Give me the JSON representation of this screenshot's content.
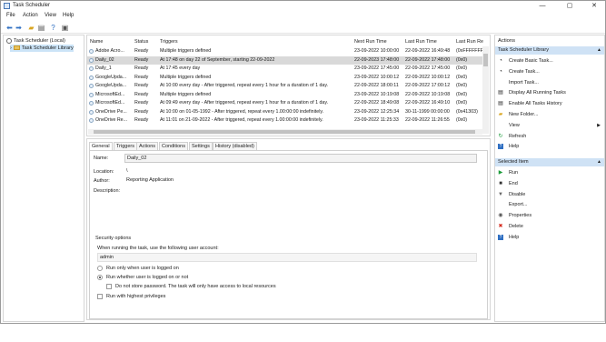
{
  "window": {
    "title": "Task Scheduler",
    "controls": {
      "minimize": "—",
      "maximize": "▢",
      "close": "✕"
    }
  },
  "menu": [
    "File",
    "Action",
    "View",
    "Help"
  ],
  "toolbar": {
    "icons": [
      "back-arrow-icon",
      "forward-arrow-icon",
      "folder-icon",
      "properties-icon",
      "help-icon",
      "panel-icon"
    ]
  },
  "tree": {
    "root": "Task Scheduler (Local)",
    "child": "Task Scheduler Library"
  },
  "tasklist": {
    "columns": [
      "Name",
      "Status",
      "Triggers",
      "Next Run Time",
      "Last Run Time",
      "Last Run Re"
    ],
    "rows": [
      {
        "name": "Adobe Acro...",
        "status": "Ready",
        "triggers": "Multiple triggers defined",
        "next": "23-09-2022 10:00:00",
        "last": "22-09-2022 16:49:48",
        "result": "(0xFFFFFFFF"
      },
      {
        "name": "Daily_02",
        "status": "Ready",
        "triggers": "At 17:48  on day 22 of September, starting 22-09-2022",
        "next": "22-09-2023 17:48:00",
        "last": "22-09-2022 17:48:00",
        "result": "(0x0)"
      },
      {
        "name": "Daily_1",
        "status": "Ready",
        "triggers": "At 17:45 every day",
        "next": "23-09-2022 17:45:00",
        "last": "22-09-2022 17:45:00",
        "result": "(0x0)"
      },
      {
        "name": "GoogleUpda...",
        "status": "Ready",
        "triggers": "Multiple triggers defined",
        "next": "23-09-2022 10:00:12",
        "last": "22-09-2022 10:00:12",
        "result": "(0x0)"
      },
      {
        "name": "GoogleUpda...",
        "status": "Ready",
        "triggers": "At 10:00 every day - After triggered, repeat every 1 hour for a duration of 1 day.",
        "next": "22-09-2022 18:00:11",
        "last": "22-09-2022 17:00:12",
        "result": "(0x0)"
      },
      {
        "name": "MicrosoftEd...",
        "status": "Ready",
        "triggers": "Multiple triggers defined",
        "next": "23-09-2022 10:19:08",
        "last": "22-09-2022 10:19:08",
        "result": "(0x0)"
      },
      {
        "name": "MicrosoftEd...",
        "status": "Ready",
        "triggers": "At 09:49 every day - After triggered, repeat every 1 hour for a duration of 1 day.",
        "next": "22-09-2022 18:49:08",
        "last": "22-09-2022 16:49:10",
        "result": "(0x0)"
      },
      {
        "name": "OneDrive Pe...",
        "status": "Ready",
        "triggers": "At 10:00 on 01-05-1992 - After triggered, repeat every 1.00:00:00 indefinitely.",
        "next": "23-09-2022 12:25:34",
        "last": "30-11-1999 00:00:00",
        "result": "(0x41303)"
      },
      {
        "name": "OneDrive Re...",
        "status": "Ready",
        "triggers": "At 11:01 on 21-09-2022 - After triggered, repeat every 1.00:00:00 indefinitely.",
        "next": "23-09-2022 11:25:33",
        "last": "22-09-2022 11:26:55",
        "result": "(0x0)"
      }
    ],
    "selected_index": 1
  },
  "details": {
    "tabs": [
      "General",
      "Triggers",
      "Actions",
      "Conditions",
      "Settings",
      "History (disabled)"
    ],
    "name_label": "Name:",
    "name_value": "Daily_02",
    "location_label": "Location:",
    "location_value": "\\",
    "author_label": "Author:",
    "author_value": "Reporting Application",
    "description_label": "Description:",
    "description_value": "",
    "security_title": "Security options",
    "account_prompt": "When running the task, use the following user account:",
    "account_value": "admin",
    "opt_logged_on": "Run only when user is logged on",
    "opt_logged_on_or_not": "Run whether user is logged on or not",
    "opt_no_password": "Do not store password.  The task will only have access to local resources",
    "opt_highest": "Run with highest privileges"
  },
  "actions_pane": {
    "header": "Actions",
    "library_section": "Task Scheduler Library",
    "library_items": [
      {
        "label": "Create Basic Task...",
        "icon": "create-basic-task-icon"
      },
      {
        "label": "Create Task...",
        "icon": "create-task-icon"
      },
      {
        "label": "Import Task...",
        "icon": "import-icon"
      },
      {
        "label": "Display All Running Tasks",
        "icon": "running-tasks-icon"
      },
      {
        "label": "Enable All Tasks History",
        "icon": "history-icon"
      },
      {
        "label": "New Folder...",
        "icon": "new-folder-icon"
      },
      {
        "label": "View",
        "icon": "view-icon",
        "submenu": "▶"
      },
      {
        "label": "Refresh",
        "icon": "refresh-icon"
      },
      {
        "label": "Help",
        "icon": "help-icon"
      }
    ],
    "selected_section": "Selected Item",
    "selected_items": [
      {
        "label": "Run",
        "icon": "run-icon"
      },
      {
        "label": "End",
        "icon": "end-icon"
      },
      {
        "label": "Disable",
        "icon": "disable-icon"
      },
      {
        "label": "Export...",
        "icon": "export-icon"
      },
      {
        "label": "Properties",
        "icon": "properties-icon"
      },
      {
        "label": "Delete",
        "icon": "delete-icon"
      },
      {
        "label": "Help",
        "icon": "help-icon"
      }
    ],
    "collapse_caret": "▲"
  },
  "colors": {
    "section_header": "#cfe2f5",
    "selection": "#cce4f7",
    "accent": "#2f6fc2"
  }
}
